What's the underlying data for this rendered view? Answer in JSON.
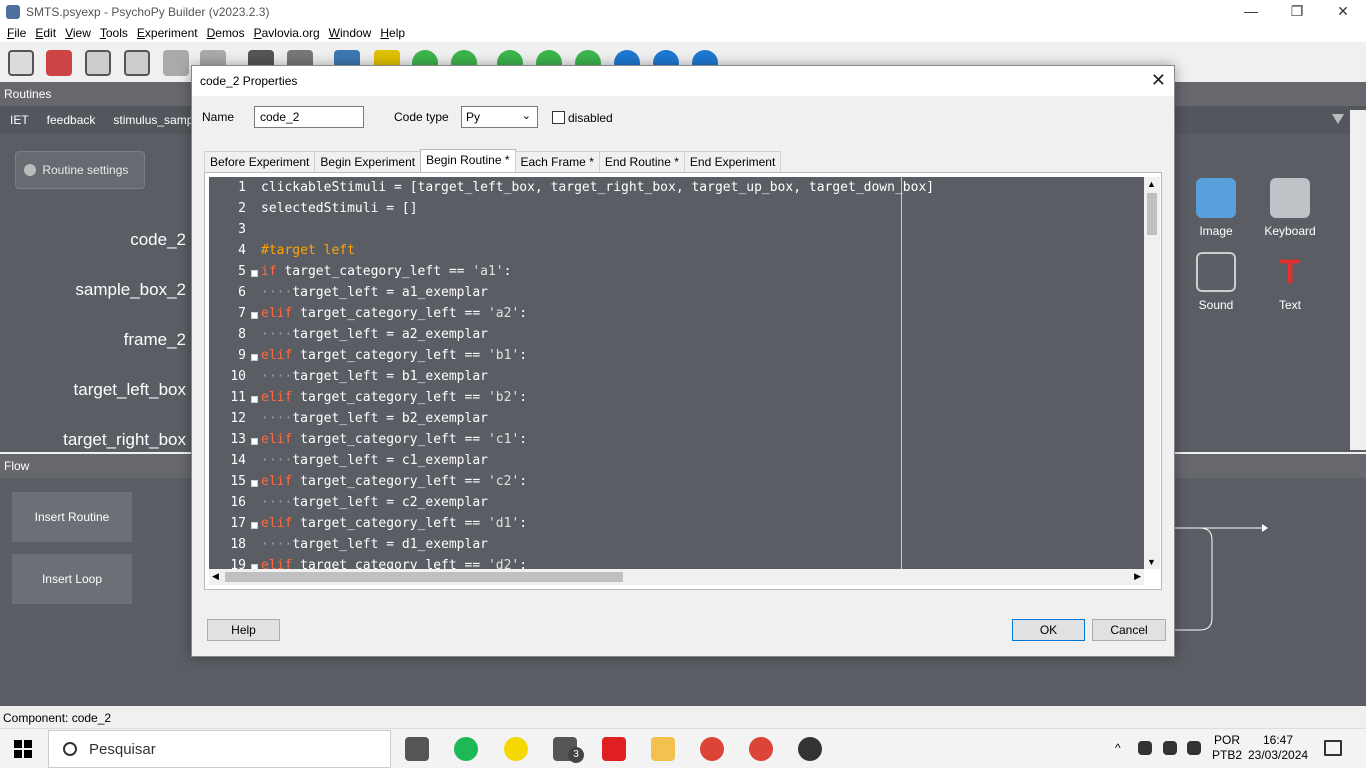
{
  "window": {
    "title": "SMTS.psyexp - PsychoPy Builder (v2023.2.3)",
    "minimize": "—",
    "restore": "❐",
    "close": "✕"
  },
  "menu": [
    "File",
    "Edit",
    "View",
    "Tools",
    "Experiment",
    "Demos",
    "Pavlovia.org",
    "Window",
    "Help"
  ],
  "routines": {
    "header": "Routines",
    "tabs": [
      "IET",
      "feedback",
      "stimulus_samp"
    ],
    "settings_label": "Routine settings",
    "components": [
      "code_2",
      "sample_box_2",
      "frame_2",
      "target_left_box",
      "target_right_box"
    ]
  },
  "components_panel": {
    "items": [
      {
        "label": "Image",
        "icon": "image-icon"
      },
      {
        "label": "Keyboard",
        "icon": "keyboard-icon"
      },
      {
        "label": "Sound",
        "icon": "speaker-icon"
      },
      {
        "label": "Text",
        "icon": "text-t-icon"
      }
    ]
  },
  "flow": {
    "header": "Flow",
    "insert_routine": "Insert Routine",
    "insert_loop": "Insert Loop"
  },
  "status": "Component: code_2",
  "dialog": {
    "title": "code_2 Properties",
    "close": "✕",
    "name_label": "Name",
    "name_value": "code_2",
    "code_type_label": "Code type",
    "code_type_value": "Py",
    "disabled_label": "disabled",
    "tabs": [
      "Before Experiment",
      "Begin Experiment",
      "Begin Routine *",
      "Each Frame *",
      "End Routine *",
      "End Experiment"
    ],
    "active_tab": "Begin Routine *",
    "code_lines": [
      "clickableStimuli = [target_left_box, target_right_box, target_up_box, target_down_box]",
      "selectedStimuli = []",
      "",
      "#target left",
      "if target_category_left == 'a1':",
      "    target_left = a1_exemplar",
      "elif target_category_left == 'a2':",
      "    target_left = a2_exemplar",
      "elif target_category_left == 'b1':",
      "    target_left = b1_exemplar",
      "elif target_category_left == 'b2':",
      "    target_left = b2_exemplar",
      "elif target_category_left == 'c1':",
      "    target_left = c1_exemplar",
      "elif target_category_left == 'c2':",
      "    target_left = c2_exemplar",
      "elif target_category_left == 'd1':",
      "    target_left = d1_exemplar",
      "elif target_category_left == 'd2':"
    ],
    "help": "Help",
    "ok": "OK",
    "cancel": "Cancel"
  },
  "taskbar": {
    "search_placeholder": "Pesquisar",
    "mail_badge": "3",
    "language": "POR",
    "layout": "PTB2",
    "time": "16:47",
    "date": "23/03/2024"
  },
  "colors": {
    "accent": "#0078d7",
    "panel": "#5a5d63",
    "header": "#66686e",
    "keyword": "#ff6b3d",
    "comment": "#ffa500"
  }
}
